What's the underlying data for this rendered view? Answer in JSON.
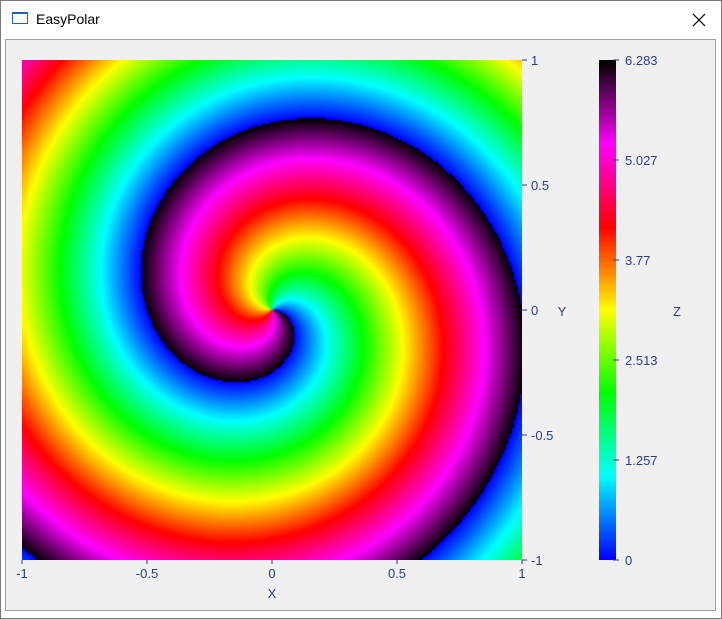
{
  "window": {
    "title": "EasyPolar",
    "close_icon": "close-icon"
  },
  "chart_data": {
    "type": "heatmap",
    "function": "z = angle(x,y) + 2*pi*r (mod 2*pi)",
    "xlabel": "X",
    "ylabel": "Y",
    "zlabel": "Z",
    "xlim": [
      -1,
      1
    ],
    "ylim": [
      -1,
      1
    ],
    "zlim": [
      0,
      6.283
    ],
    "x_ticks": [
      "-1",
      "-0.5",
      "0",
      "0.5",
      "1"
    ],
    "y_ticks": [
      "1",
      "0.5",
      "0",
      "-0.5",
      "-1"
    ],
    "z_ticks": [
      "6.283",
      "5.027",
      "3.77",
      "2.513",
      "1.257",
      "0"
    ],
    "colorscale": [
      "#0000ff",
      "#00ffff",
      "#00ff00",
      "#ffff00",
      "#ff0000",
      "#ff00ff",
      "#000000"
    ],
    "grid": false
  },
  "colors": {
    "axis_text": "#2e3b8c",
    "panel_bg": "#f0f0f0"
  }
}
